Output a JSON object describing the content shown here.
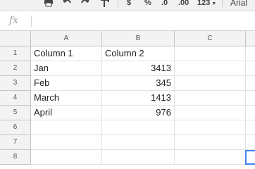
{
  "toolbar": {
    "items": [
      {
        "name": "print-icon",
        "label": ""
      },
      {
        "name": "undo-icon",
        "label": ""
      },
      {
        "name": "redo-icon",
        "label": ""
      },
      {
        "name": "paint-format-icon",
        "label": ""
      },
      {
        "name": "currency-format-button",
        "label": "$"
      },
      {
        "name": "percent-format-button",
        "label": "%"
      },
      {
        "name": "decrease-decimal-button",
        "label": ".0"
      },
      {
        "name": "increase-decimal-button",
        "label": ".00"
      },
      {
        "name": "more-formats-button",
        "label": "123"
      },
      {
        "name": "font-family-select",
        "label": "Arial"
      }
    ]
  },
  "formula_bar": {
    "fx_label": "fx",
    "value": ""
  },
  "grid": {
    "columns": [
      "A",
      "B",
      "C"
    ],
    "rows": [
      "1",
      "2",
      "3",
      "4",
      "5",
      "6",
      "7",
      "8"
    ],
    "cells": [
      [
        "Column 1",
        "Column 2",
        ""
      ],
      [
        "Jan",
        "3413",
        ""
      ],
      [
        "Feb",
        "345",
        ""
      ],
      [
        "March",
        "1413",
        ""
      ],
      [
        "April",
        "976",
        ""
      ],
      [
        "",
        "",
        ""
      ],
      [
        "",
        "",
        ""
      ],
      [
        "",
        "",
        ""
      ]
    ]
  },
  "colors": {
    "header_bg": "#f3f3f3",
    "gridline": "#e2e2e2",
    "selection": "#4285f4"
  }
}
